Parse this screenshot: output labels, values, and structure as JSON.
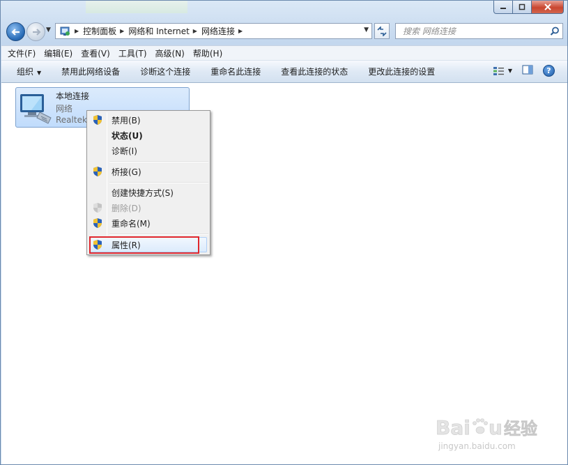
{
  "address": {
    "crumbs": [
      "控制面板",
      "网络和 Internet",
      "网络连接"
    ]
  },
  "search": {
    "placeholder": "搜索 网络连接"
  },
  "menu": [
    "文件(F)",
    "编辑(E)",
    "查看(V)",
    "工具(T)",
    "高级(N)",
    "帮助(H)"
  ],
  "commands": {
    "organize": "组织",
    "disable": "禁用此网络设备",
    "diagnose": "诊断这个连接",
    "rename": "重命名此连接",
    "status": "查看此连接的状态",
    "settings": "更改此连接的设置"
  },
  "connection": {
    "name": "本地连接",
    "network": "网络",
    "device": "Realtek"
  },
  "context_menu": {
    "disable": "禁用(B)",
    "status": "状态(U)",
    "diagnose": "诊断(I)",
    "bridge": "桥接(G)",
    "shortcut": "创建快捷方式(S)",
    "delete": "删除(D)",
    "rename": "重命名(M)",
    "properties": "属性(R)"
  },
  "watermark": {
    "url": "jingyan.baidu.com"
  },
  "colors": {
    "accent": "#2a6db8",
    "highlight_box": "#e0262c",
    "shield_blue": "#2b62b8",
    "shield_yellow": "#f1c232"
  }
}
